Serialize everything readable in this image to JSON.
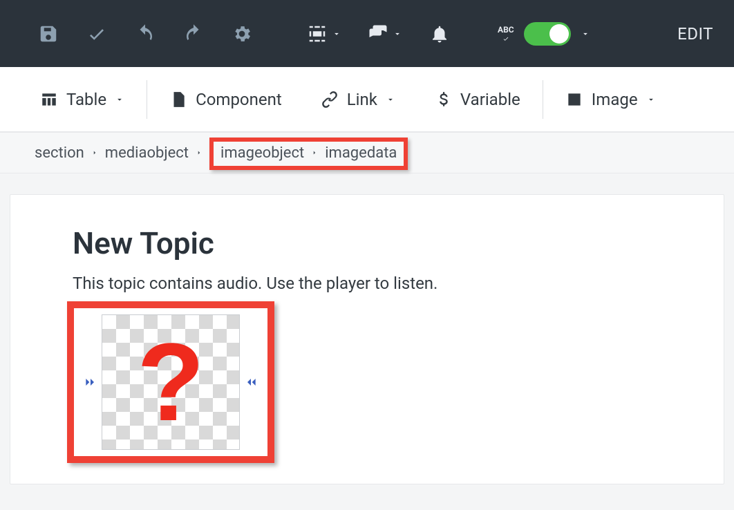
{
  "topbar": {
    "abc_label": "ABC",
    "edit_label": "EDIT"
  },
  "toolbar": {
    "table_label": "Table",
    "component_label": "Component",
    "link_label": "Link",
    "variable_label": "Variable",
    "image_label": "Image"
  },
  "breadcrumb": {
    "items": [
      "section",
      "mediaobject",
      "imageobject",
      "imagedata"
    ]
  },
  "document": {
    "title": "New Topic",
    "paragraph": "This topic contains audio. Use the player to listen.",
    "placeholder_glyph": "?"
  },
  "colors": {
    "highlight": "#ef4135",
    "toggle_on": "#4bbf4b",
    "toolbar_bg": "#2b333b"
  }
}
